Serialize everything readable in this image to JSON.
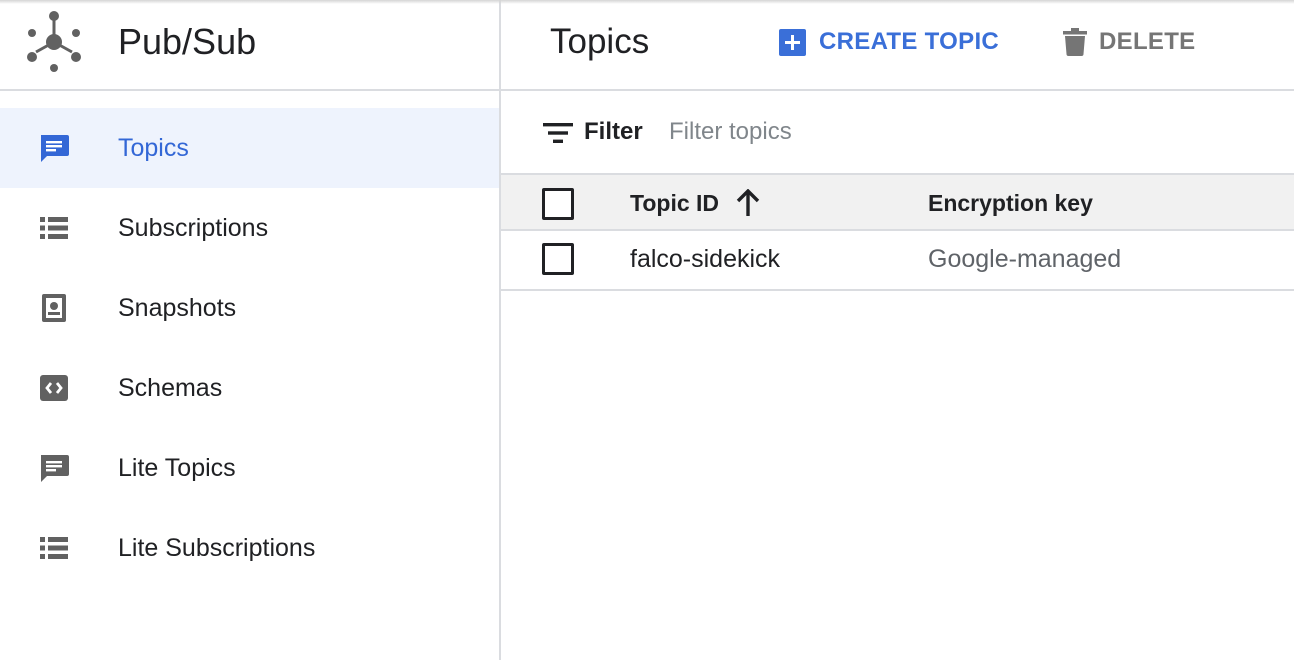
{
  "app": {
    "title": "Pub/Sub",
    "logo_icon": "pubsub-hub-icon"
  },
  "colors": {
    "accent": "#3a6fd8",
    "active_nav_bg": "#eef3fd",
    "active_nav_text": "#3367d6",
    "icon_gray": "#616161",
    "muted_text": "#5f6368"
  },
  "sidebar": {
    "items": [
      {
        "label": "Topics",
        "icon": "chat-message-icon",
        "active": true
      },
      {
        "label": "Subscriptions",
        "icon": "list-icon",
        "active": false
      },
      {
        "label": "Snapshots",
        "icon": "snapshot-icon",
        "active": false
      },
      {
        "label": "Schemas",
        "icon": "code-icon",
        "active": false
      },
      {
        "label": "Lite Topics",
        "icon": "chat-message-icon",
        "active": false
      },
      {
        "label": "Lite Subscriptions",
        "icon": "list-icon",
        "active": false
      }
    ]
  },
  "header": {
    "page_title": "Topics",
    "create_label": "CREATE TOPIC",
    "delete_label": "DELETE"
  },
  "filter": {
    "label": "Filter",
    "placeholder": "Filter topics",
    "value": ""
  },
  "table": {
    "columns": [
      "Topic ID",
      "Encryption key"
    ],
    "sort": {
      "column": "Topic ID",
      "direction": "ascending"
    },
    "rows": [
      {
        "topic_id": "falco-sidekick",
        "encryption_key": "Google-managed",
        "checked": false
      }
    ]
  }
}
